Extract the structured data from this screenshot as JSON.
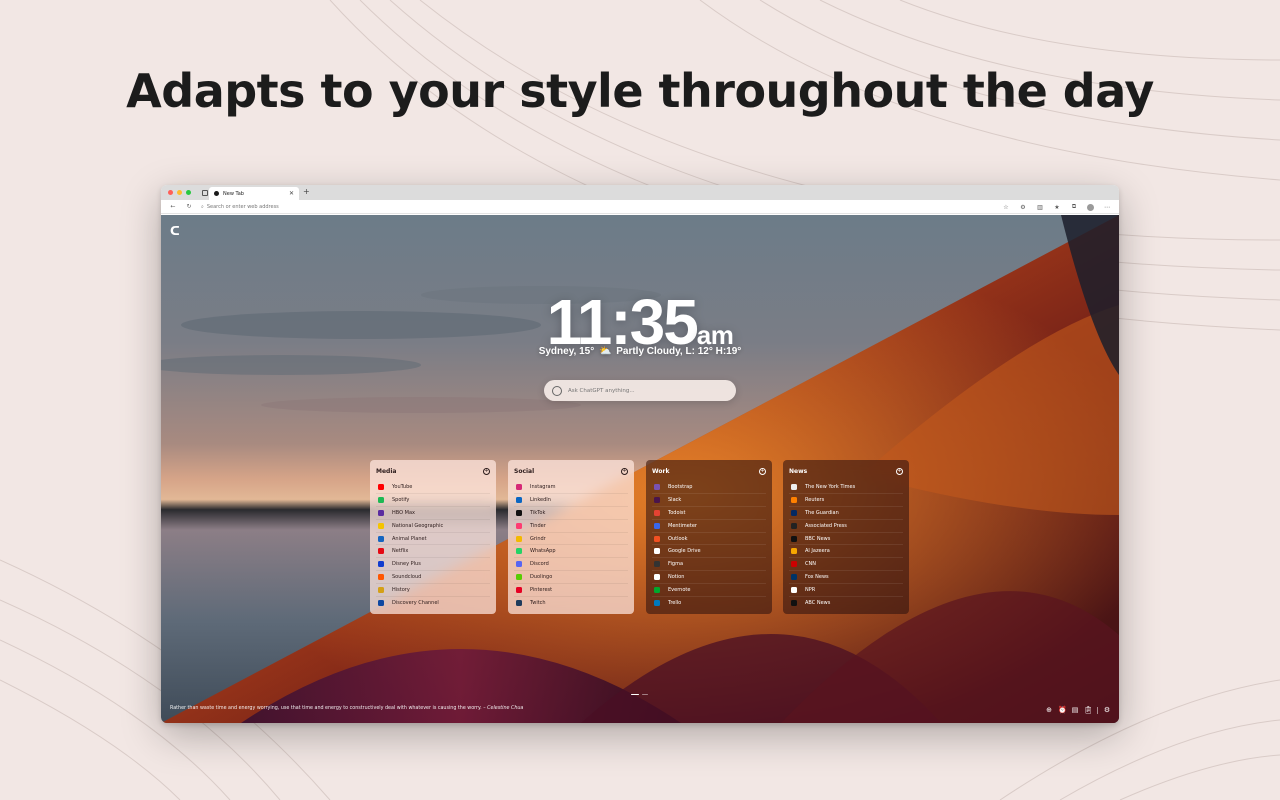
{
  "headline": "Adapts to your style throughout the day",
  "browser": {
    "tab_title": "New Tab",
    "address_placeholder": "Search or enter web address"
  },
  "clock": {
    "time": "11:35",
    "ampm": "am"
  },
  "weather": {
    "location_temp": "Sydney, 15°",
    "condition": "Partly Cloudy, L: 12° H:19°",
    "icon": "partly-cloudy-icon"
  },
  "search": {
    "placeholder": "Ask ChatGPT anything..."
  },
  "cards": [
    {
      "title": "Media",
      "links": [
        {
          "label": "YouTube",
          "color": "#ff0000"
        },
        {
          "label": "Spotify",
          "color": "#1db954"
        },
        {
          "label": "HBO Max",
          "color": "#5a2ca0"
        },
        {
          "label": "National Geographic",
          "color": "#f5c400"
        },
        {
          "label": "Animal Planet",
          "color": "#1565c0"
        },
        {
          "label": "Netflix",
          "color": "#e50914"
        },
        {
          "label": "Disney Plus",
          "color": "#113ccf"
        },
        {
          "label": "Soundcloud",
          "color": "#ff5500"
        },
        {
          "label": "History",
          "color": "#d4a017"
        },
        {
          "label": "Discovery Channel",
          "color": "#0d47a1"
        }
      ]
    },
    {
      "title": "Social",
      "links": [
        {
          "label": "Instagram",
          "color": "#d62976"
        },
        {
          "label": "LinkedIn",
          "color": "#0a66c2"
        },
        {
          "label": "TikTok",
          "color": "#111111"
        },
        {
          "label": "Tinder",
          "color": "#fe3c72"
        },
        {
          "label": "Grindr",
          "color": "#f3b900"
        },
        {
          "label": "WhatsApp",
          "color": "#25d366"
        },
        {
          "label": "Discord",
          "color": "#5865f2"
        },
        {
          "label": "Duolingo",
          "color": "#58cc02"
        },
        {
          "label": "Pinterest",
          "color": "#e60023"
        },
        {
          "label": "Twitch",
          "color": "#1f3b5c"
        }
      ]
    },
    {
      "title": "Work",
      "links": [
        {
          "label": "Bootstrap",
          "color": "#7952b3"
        },
        {
          "label": "Slack",
          "color": "#4a154b"
        },
        {
          "label": "Todoist",
          "color": "#e44332"
        },
        {
          "label": "Mentimeter",
          "color": "#3a66e8"
        },
        {
          "label": "Outlook",
          "color": "#f25022"
        },
        {
          "label": "Google Drive",
          "color": "#ffffff"
        },
        {
          "label": "Figma",
          "color": "#333333"
        },
        {
          "label": "Notion",
          "color": "#ffffff"
        },
        {
          "label": "Evernote",
          "color": "#00a82d"
        },
        {
          "label": "Trello",
          "color": "#0079bf"
        }
      ]
    },
    {
      "title": "News",
      "links": [
        {
          "label": "The New York Times",
          "color": "#eeeeee"
        },
        {
          "label": "Reuters",
          "color": "#ff8000"
        },
        {
          "label": "The Guardian",
          "color": "#052962"
        },
        {
          "label": "Associated Press",
          "color": "#222222"
        },
        {
          "label": "BBC News",
          "color": "#111111"
        },
        {
          "label": "Al Jazeera",
          "color": "#f7a600"
        },
        {
          "label": "CNN",
          "color": "#cc0000"
        },
        {
          "label": "Fox News",
          "color": "#003366"
        },
        {
          "label": "NPR",
          "color": "#ffffff"
        },
        {
          "label": "ABC News",
          "color": "#111111"
        }
      ]
    }
  ],
  "quote": {
    "text": "Rather than waste time and energy worrying, use that time and energy to constructively deal with whatever is causing the worry. –",
    "author": "Celestine Chua"
  },
  "colors": {
    "page_bg": "#f2e7e4",
    "headline": "#1c1c1c"
  }
}
